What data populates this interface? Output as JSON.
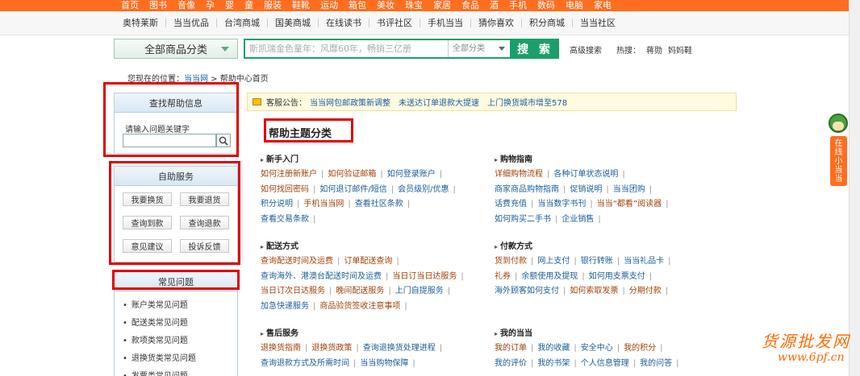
{
  "topnav": [
    "首页",
    "图书",
    "音像",
    "孕",
    "婴",
    "童",
    "服装",
    "鞋靴",
    "运动",
    "箱包",
    "美妆",
    "珠宝",
    "家居",
    "食品",
    "酒",
    "手机",
    "数码",
    "电脑",
    "家电"
  ],
  "channels": [
    "奥特莱斯",
    "当当优品",
    "台湾商城",
    "国美商城",
    "在线读书",
    "书评社区",
    "手机当当",
    "猜你喜欢",
    "积分商城",
    "当当社区"
  ],
  "search": {
    "category_button": "全部商品分类",
    "placeholder": "斯凯瑞金色童年：风靡60年，畅销三亿册",
    "select_value": "全部分类",
    "button": "搜 索",
    "advanced": "高级搜索",
    "hot_label": "热搜：",
    "hot_items": [
      "蒋勋",
      "妈妈鞋"
    ]
  },
  "breadcrumb": {
    "prefix": "您现在的位置：",
    "home": "当当网",
    "sep": " > ",
    "current": "帮助中心首页"
  },
  "find_help": {
    "title": "查找帮助信息",
    "label": "请输入问题关键字"
  },
  "self_service": {
    "title": "自助服务",
    "buttons": [
      "我要换货",
      "我要退货",
      "查询到款",
      "查询退款",
      "意见建议",
      "投诉反馈"
    ]
  },
  "faq": {
    "title": "常见问题",
    "items": [
      "账户类常见问题",
      "配送类常见问题",
      "款项类常见问题",
      "退换货类常见问题",
      "发票类常见问题"
    ]
  },
  "notice": {
    "label": "客服公告：",
    "items": [
      "当当网包邮政策新调整",
      "未送达订单退款大提速",
      "上门换货城市增至578"
    ]
  },
  "section_title": "帮助主题分类",
  "categories": [
    {
      "title": "新手入门",
      "lines": [
        [
          {
            "t": "如何注册新账户",
            "c": "brown"
          },
          {
            "t": "如何验证邮箱",
            "c": "brown"
          },
          {
            "t": "如何登录账户",
            "c": "blue"
          }
        ],
        [
          {
            "t": "如何找回密码",
            "c": "brown"
          },
          {
            "t": "如何退订邮件/短信",
            "c": "blue"
          },
          {
            "t": "会员级别/优惠",
            "c": "blue"
          }
        ],
        [
          {
            "t": "积分说明",
            "c": "blue"
          },
          {
            "t": "手机当当网",
            "c": "brown"
          },
          {
            "t": "查看社区条款",
            "c": "blue"
          }
        ],
        [
          {
            "t": "查看交易条款",
            "c": "blue"
          }
        ]
      ]
    },
    {
      "title": "购物指南",
      "lines": [
        [
          {
            "t": "详细购物流程",
            "c": "brown"
          },
          {
            "t": "各种订单状态说明",
            "c": "blue"
          }
        ],
        [
          {
            "t": "商家商品购物指南",
            "c": "blue"
          },
          {
            "t": "促销说明",
            "c": "blue"
          },
          {
            "t": "当当团购",
            "c": "blue"
          }
        ],
        [
          {
            "t": "话费充值",
            "c": "blue"
          },
          {
            "t": "当当数字书刊",
            "c": "blue"
          },
          {
            "t": "当当“都看”阅读器",
            "c": "brown"
          }
        ],
        [
          {
            "t": "如何购买二手书",
            "c": "blue"
          },
          {
            "t": "企业销售",
            "c": "blue"
          }
        ]
      ]
    },
    {
      "title": "配送方式",
      "lines": [
        [
          {
            "t": "查询配送时间及运费",
            "c": "brown"
          },
          {
            "t": "订单配送查询",
            "c": "brown"
          }
        ],
        [
          {
            "t": "查询海外、港澳台配送时间及运费",
            "c": "blue"
          },
          {
            "t": "当日订当日达服务",
            "c": "brown"
          }
        ],
        [
          {
            "t": "当日订次日达服务",
            "c": "brown"
          },
          {
            "t": "晚间配送服务",
            "c": "brown"
          },
          {
            "t": "上门自提服务",
            "c": "blue"
          }
        ],
        [
          {
            "t": "加急快递服务",
            "c": "blue"
          },
          {
            "t": "商品验货签收注意事项",
            "c": "brown"
          }
        ]
      ]
    },
    {
      "title": "付款方式",
      "lines": [
        [
          {
            "t": "货到付款",
            "c": "brown"
          },
          {
            "t": "网上支付",
            "c": "blue"
          },
          {
            "t": "银行转账",
            "c": "blue"
          },
          {
            "t": "当当礼品卡",
            "c": "blue"
          }
        ],
        [
          {
            "t": "礼券",
            "c": "brown"
          },
          {
            "t": "余额使用及提现",
            "c": "blue"
          },
          {
            "t": "如何用支票支付",
            "c": "blue"
          }
        ],
        [
          {
            "t": "海外顾客如何支付",
            "c": "blue"
          },
          {
            "t": "如何索取发票",
            "c": "brown"
          },
          {
            "t": "分期付款",
            "c": "brown"
          }
        ]
      ]
    },
    {
      "title": "售后服务",
      "lines": [
        [
          {
            "t": "退换货指南",
            "c": "brown"
          },
          {
            "t": "退换货政策",
            "c": "brown"
          },
          {
            "t": "查询退换货处理进程",
            "c": "blue"
          }
        ],
        [
          {
            "t": "查询退款方式及所需时间",
            "c": "blue"
          },
          {
            "t": "当当购物保障",
            "c": "blue"
          }
        ]
      ]
    },
    {
      "title": "我的当当",
      "lines": [
        [
          {
            "t": "我的订单",
            "c": "brown"
          },
          {
            "t": "我的收藏",
            "c": "blue"
          },
          {
            "t": "安全中心",
            "c": "blue"
          },
          {
            "t": "我的积分",
            "c": "brown"
          }
        ],
        [
          {
            "t": "我的评价",
            "c": "blue"
          },
          {
            "t": "我的书架",
            "c": "blue"
          },
          {
            "t": "个人信息管理",
            "c": "blue"
          },
          {
            "t": "我的问答",
            "c": "blue"
          }
        ]
      ]
    }
  ],
  "helper_tab": "在线小当当",
  "watermark": {
    "line1": "货源批发网",
    "line2": "www.6pf.cn"
  }
}
